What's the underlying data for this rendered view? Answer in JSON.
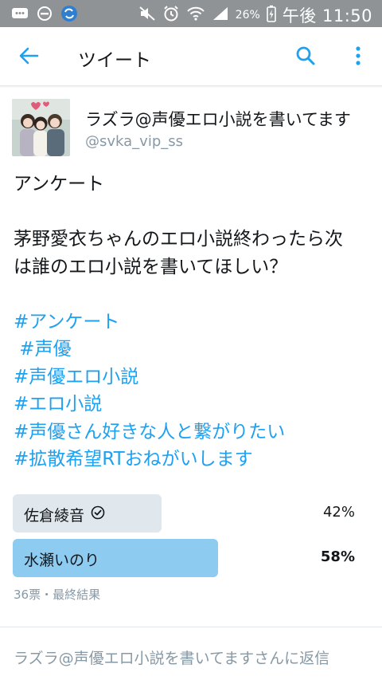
{
  "status_bar": {
    "battery_pct": "26%",
    "time": "午後 11:50"
  },
  "appbar": {
    "title": "ツイート"
  },
  "tweet": {
    "display_name": "ラズラ@声優エロ小説を書いてます",
    "handle": "@svka_vip_ss",
    "text_lines": [
      "アンケート",
      "",
      "茅野愛衣ちゃんのエロ小説終わったら次",
      "は誰のエロ小説を書いてほしい？",
      ""
    ],
    "hashtags": [
      "#アンケート",
      " #声優",
      "#声優エロ小説",
      "#エロ小説",
      "#声優さん好きな人と繋がりたい",
      "#拡散希望RTおねがいします"
    ]
  },
  "poll": {
    "options": [
      {
        "label": "佐倉綾音",
        "percent": "42%",
        "value": 0.42,
        "selected_by_user": true,
        "winner": false
      },
      {
        "label": "水瀬いのり",
        "percent": "58%",
        "value": 0.58,
        "selected_by_user": false,
        "winner": true
      }
    ],
    "meta": "36票・最終結果",
    "colors": {
      "winner": "#8ecbf1",
      "other": "#e1e8ed"
    }
  },
  "reply": {
    "placeholder": "ラズラ@声優エロ小説を書いてますさんに返信"
  }
}
